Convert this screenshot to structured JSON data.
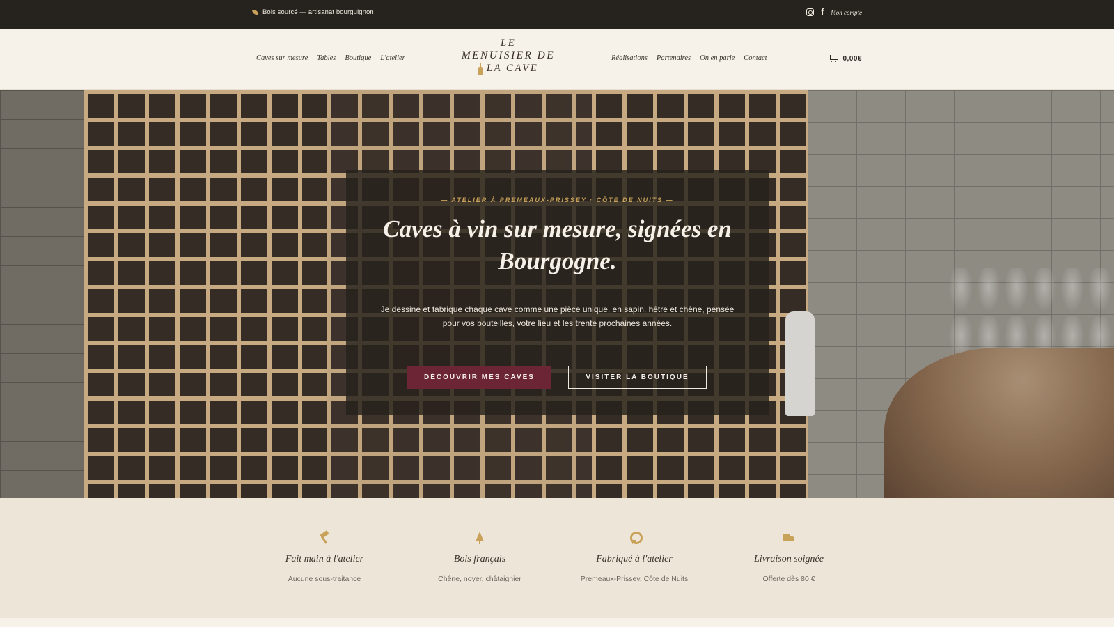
{
  "topbar": {
    "tagline": "Bois sourcé — artisanat bourguignon",
    "account_label": "Mon compte",
    "icons": [
      "instagram-icon",
      "facebook-icon",
      "leaf-icon"
    ]
  },
  "header": {
    "nav_left": [
      "Caves sur mesure",
      "Tables",
      "Boutique",
      "L'atelier"
    ],
    "nav_right": [
      "Réalisations",
      "Partenaires",
      "On en parle",
      "Contact"
    ],
    "logo": {
      "line1": "LE",
      "line2": "MENUISIER DE",
      "line3": "LA CAVE"
    },
    "cart_total": "0,00€"
  },
  "hero": {
    "kicker": "— ATELIER À PREMEAUX-PRISSEY · CÔTE DE NUITS —",
    "title": "Caves à vin sur mesure, signées en Bourgogne.",
    "text": "Je dessine et fabrique chaque cave comme une pièce unique, en sapin, hêtre et chêne, pensée pour vos bouteilles, votre lieu et les trente prochaines années.",
    "primary_button": "DÉCOUVRIR MES CAVES",
    "secondary_button": "VISITER LA BOUTIQUE"
  },
  "features": [
    {
      "title": "Fait main à l'atelier",
      "subtitle": "Aucune sous-traitance",
      "icon": "hammer-icon"
    },
    {
      "title": "Bois français",
      "subtitle": "Chêne, noyer, châtaignier",
      "icon": "tree-icon"
    },
    {
      "title": "Fabriqué à l'atelier",
      "subtitle": "Premeaux-Prissey, Côte de Nuits",
      "icon": "medal-icon"
    },
    {
      "title": "Livraison soignée",
      "subtitle": "Offerte dès 80 €",
      "icon": "truck-icon"
    }
  ],
  "colors": {
    "topbar_bg": "#26221d",
    "accent_gold": "#c9a25a",
    "primary_button": "#6b2535",
    "features_bg": "#ede6d8"
  }
}
